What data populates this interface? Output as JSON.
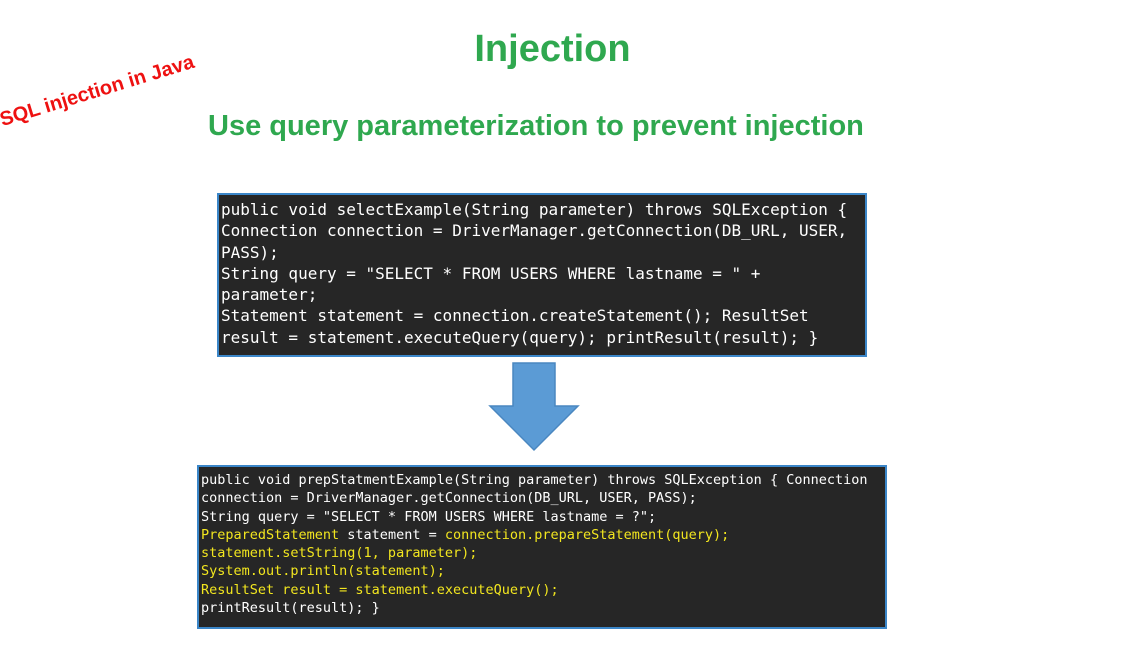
{
  "slide": {
    "title": "Injection",
    "subtitle": "Use query parameterization to prevent injection",
    "stamp": "SQL injection in Java"
  },
  "code_before": {
    "lines": [
      "public void selectExample(String parameter) throws SQLException {",
      "Connection connection = DriverManager.getConnection(DB_URL, USER,",
      "PASS);",
      "String query = \"SELECT * FROM USERS WHERE lastname = \" +",
      "parameter;",
      "Statement statement = connection.createStatement(); ResultSet",
      "result = statement.executeQuery(query); printResult(result); }"
    ]
  },
  "code_after": {
    "line1": "public void prepStatmentExample(String parameter) throws SQLException { Connection",
    "line2": "connection = DriverManager.getConnection(DB_URL, USER, PASS);",
    "line3": "String query = \"SELECT * FROM USERS WHERE lastname = ?\";",
    "line4_a": "PreparedStatement",
    "line4_b": " statement = ",
    "line4_c": "connection.prepareStatement(query);",
    "line5": "statement.setString(1, parameter);",
    "line6": "System.out.println(statement);",
    "line7": "ResultSet result = statement.executeQuery();",
    "line8": "printResult(result); }"
  },
  "colors": {
    "title_green": "#2fa84f",
    "stamp_red": "#ee1111",
    "code_background": "#262626",
    "code_border": "#3b86c8",
    "code_highlight": "#f2e61f",
    "arrow_fill": "#5b9bd5"
  },
  "icons": {
    "arrow": "down-arrow-icon"
  }
}
